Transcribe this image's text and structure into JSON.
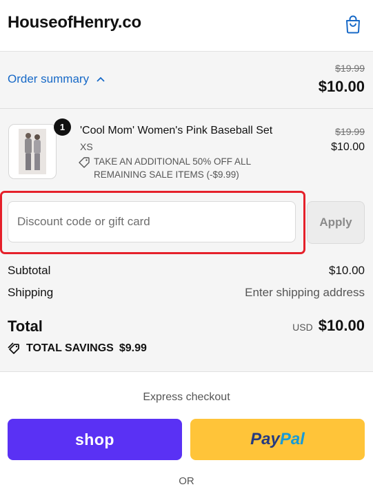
{
  "header": {
    "store_name": "HouseofHenry.co",
    "cart_icon": "shopping-bag-icon"
  },
  "summary": {
    "toggle_label": "Order summary",
    "original_total": "$19.99",
    "total": "$10.00"
  },
  "line_item": {
    "quantity": "1",
    "title": "'Cool Mom' Women's Pink Baseball Set",
    "variant": "XS",
    "discount_line1": "TAKE AN ADDITIONAL 50% OFF ALL",
    "discount_line2": "REMAINING SALE ITEMS (-$9.99)",
    "original_price": "$19.99",
    "price": "$10.00"
  },
  "discount": {
    "placeholder": "Discount code or gift card",
    "value": "",
    "apply_label": "Apply"
  },
  "totals": {
    "subtotal_label": "Subtotal",
    "subtotal_value": "$10.00",
    "shipping_label": "Shipping",
    "shipping_value": "Enter shipping address",
    "total_label": "Total",
    "currency": "USD",
    "total_value": "$10.00",
    "savings_label": "TOTAL SAVINGS",
    "savings_value": "$9.99"
  },
  "express": {
    "title": "Express checkout",
    "shop_label": "shop",
    "paypal_part1": "Pay",
    "paypal_part2": "Pal",
    "or_label": "OR"
  },
  "colors": {
    "link": "#1769c7",
    "highlight": "#e5202a",
    "shop_pay": "#5a31f4",
    "paypal": "#ffc439"
  }
}
